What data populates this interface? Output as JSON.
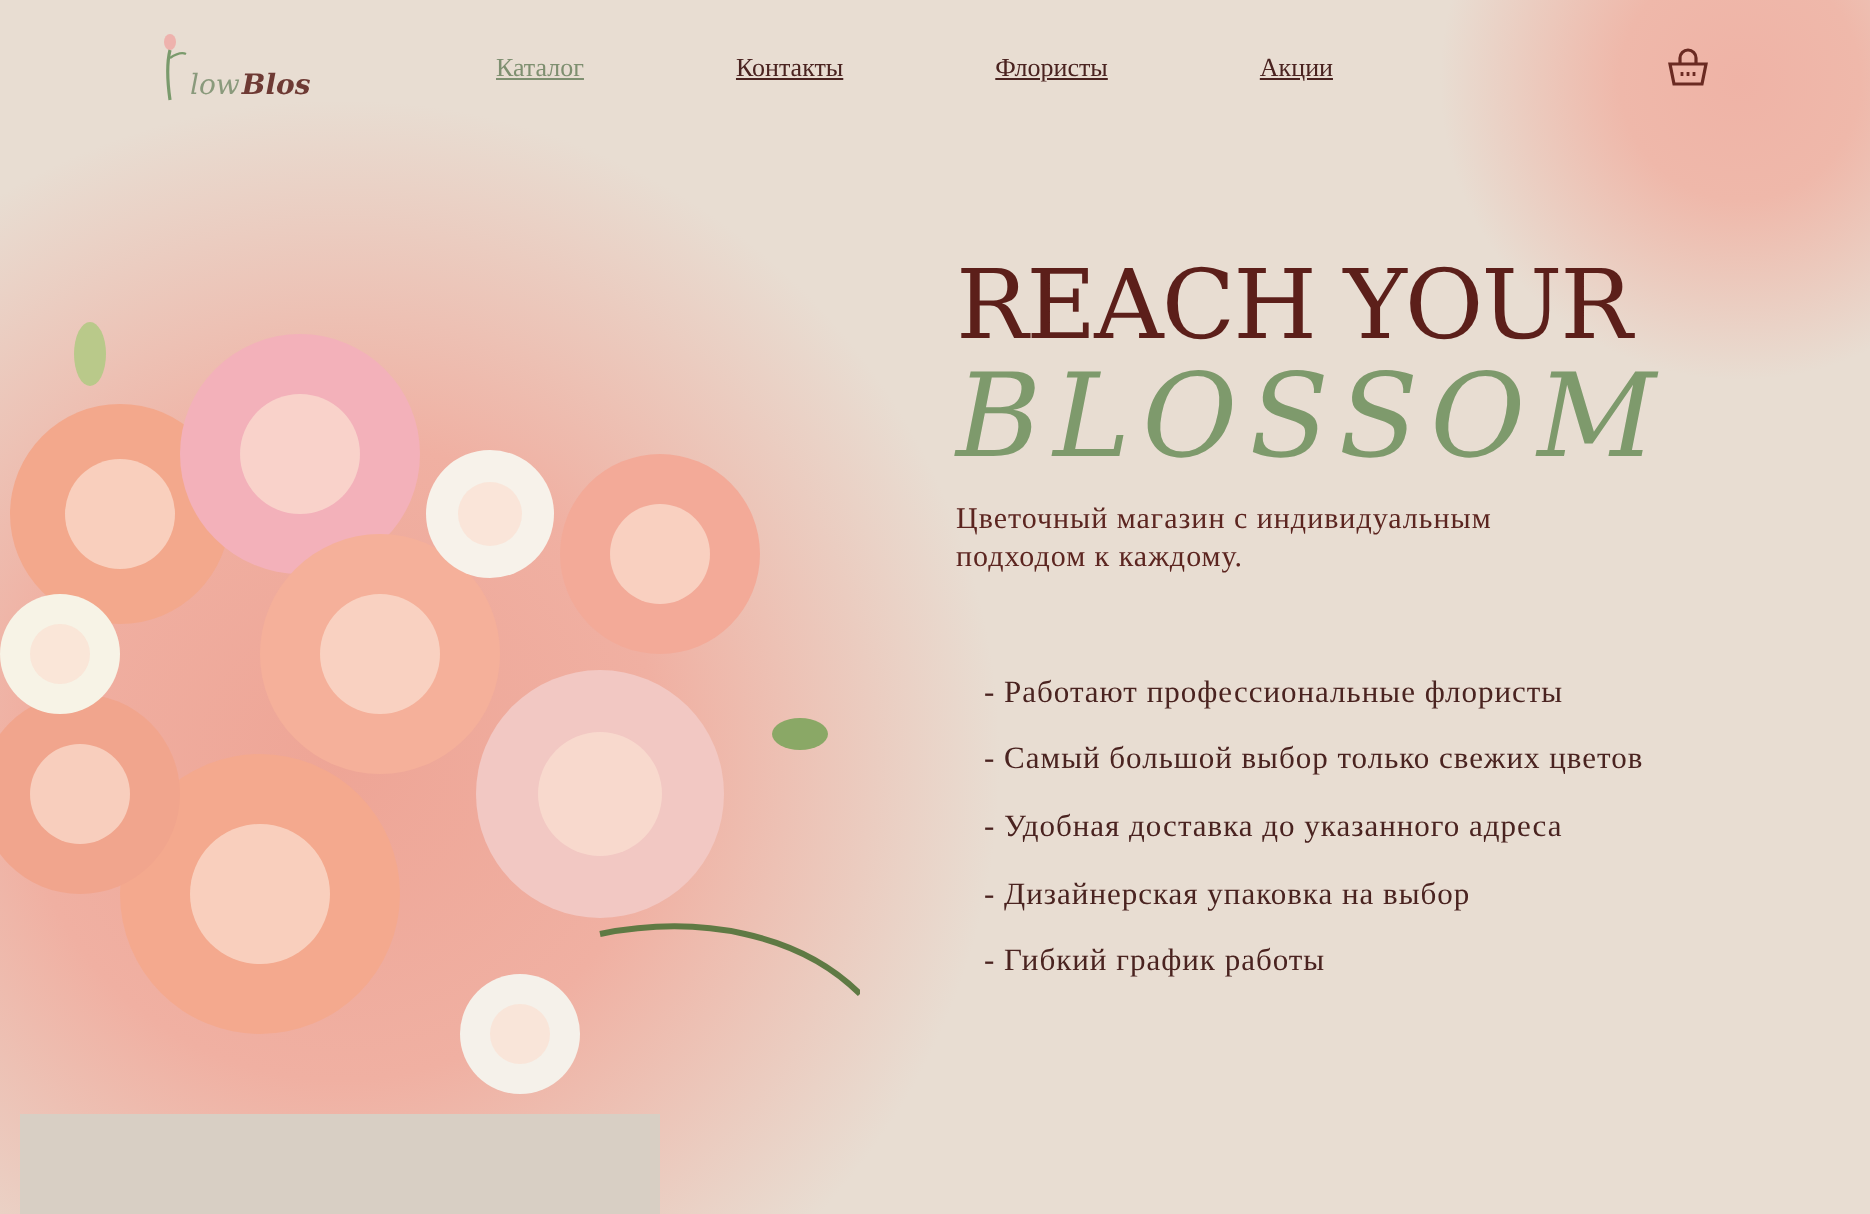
{
  "logo": {
    "light": "low",
    "dark": "Blos"
  },
  "nav": [
    {
      "label": "Каталог",
      "selected": true
    },
    {
      "label": "Контакты",
      "selected": false
    },
    {
      "label": "Флористы",
      "selected": false
    },
    {
      "label": "Акции",
      "selected": false
    }
  ],
  "hero": {
    "title": "REACH YOUR",
    "script_title": "BLOSSOM",
    "subtitle": "Цветочный магазин с индивидуальным подходом к каждому.",
    "features": [
      "- Работают профессиональные флористы",
      "- Самый большой выбор только свежих цветов",
      "- Удобная доставка до указанного адреса",
      "- Дизайнерская упаковка на выбор",
      "- Гибкий график работы"
    ]
  }
}
